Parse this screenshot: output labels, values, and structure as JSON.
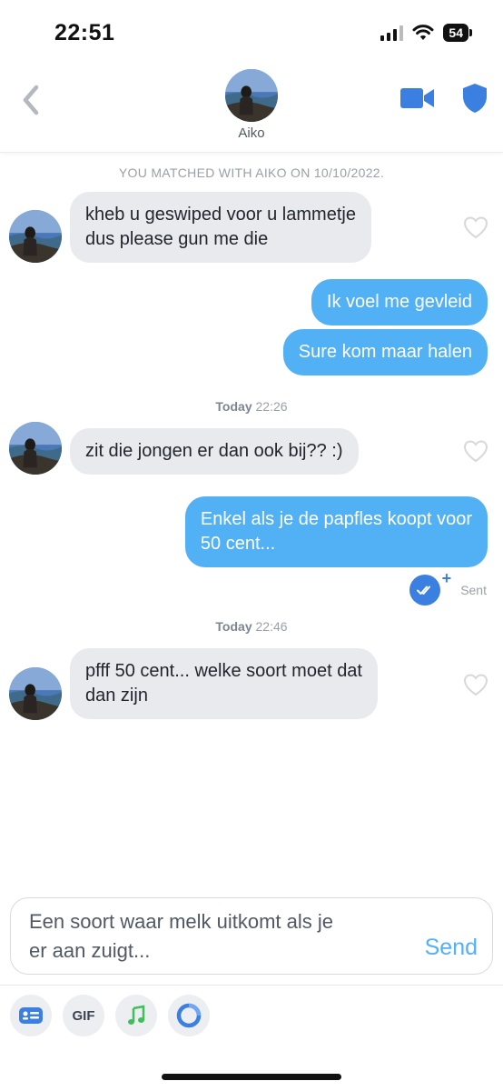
{
  "status_bar": {
    "time": "22:51",
    "battery": "54"
  },
  "header": {
    "name": "Aiko",
    "icons": [
      "back-icon",
      "video-call-icon",
      "shield-icon"
    ]
  },
  "chat": {
    "match_notice": "YOU MATCHED WITH AIKO ON 10/10/2022.",
    "separators": [
      {
        "day": "Today",
        "time": "22:26"
      },
      {
        "day": "Today",
        "time": "22:46"
      }
    ],
    "messages": [
      {
        "from": "them",
        "lines": [
          "kheb u geswiped voor u lammetje",
          "dus please gun me die"
        ]
      },
      {
        "from": "me",
        "lines": [
          "Ik voel me gevleid"
        ]
      },
      {
        "from": "me",
        "lines": [
          "Sure kom maar halen"
        ]
      },
      {
        "from": "them",
        "lines": [
          "zit die jongen er dan ook bij?? :)"
        ]
      },
      {
        "from": "me",
        "lines": [
          "Enkel als je de papfles koopt voor",
          "50 cent..."
        ]
      },
      {
        "from": "them",
        "lines": [
          "pfff 50 cent... welke soort moet dat",
          "dan zijn"
        ]
      }
    ],
    "sent_status": "Sent"
  },
  "composer": {
    "lines": [
      "Een soort waar melk uitkomt als je",
      "er aan zuigt..."
    ],
    "send_label": "Send"
  },
  "toolbar": {
    "gif_label": "GIF",
    "icons": [
      "sticker-icon",
      "gif-icon",
      "music-icon",
      "loop-icon"
    ]
  },
  "colors": {
    "accent": "#52b0f5",
    "incoming_bubble": "#e9eaee",
    "video_icon": "#3b7fe0",
    "music_icon": "#3fbf5a"
  }
}
